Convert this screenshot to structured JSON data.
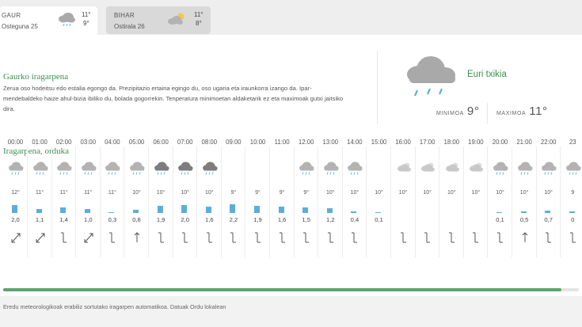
{
  "tabs": [
    {
      "label": "GAUR",
      "date": "Osteguna 25",
      "max": "11°",
      "min": "9°",
      "icon": "rain-cloud-icon"
    },
    {
      "label": "BIHAR",
      "date": "Ostirala 26",
      "max": "11°",
      "min": "8°",
      "icon": "sun-cloud-icon"
    }
  ],
  "today": {
    "title": "Gaurko iragarpena",
    "text": "Zerua oso hodeitsu edo estalia egongo da. Prezipitazio ertaina egingo du, oso ugaria eta iraunkorra izango da. Ipar-mendebaldeko haize ahul-bizia ibiliko du, bolada gogorrekin. Tenperatura minimoetan aldaketarik ez eta maximoak gutxi jaitsiko dira.",
    "condition": "Euri txikia",
    "min_label": "MINIMOA",
    "min_value": "9°",
    "max_label": "MAXIMOA",
    "max_value": "11°"
  },
  "hourly": {
    "title": "Iragarpena, orduka",
    "hours": [
      {
        "time": "00:00",
        "temp": "12°",
        "precip": "2,0",
        "mm": 2.0,
        "icon": "rain",
        "wind": "ne"
      },
      {
        "time": "01:00",
        "temp": "11°",
        "precip": "1,1",
        "mm": 1.1,
        "icon": "rain",
        "wind": "ne"
      },
      {
        "time": "02:00",
        "temp": "11°",
        "precip": "1,4",
        "mm": 1.4,
        "icon": "rain",
        "wind": "n"
      },
      {
        "time": "03:00",
        "temp": "11°",
        "precip": "1,0",
        "mm": 1.0,
        "icon": "rain",
        "wind": "ne"
      },
      {
        "time": "04:00",
        "temp": "11°",
        "precip": "0,3",
        "mm": 0.3,
        "icon": "rain",
        "wind": "n"
      },
      {
        "time": "05:00",
        "temp": "10°",
        "precip": "0,8",
        "mm": 0.8,
        "icon": "rain",
        "wind": "s"
      },
      {
        "time": "06:00",
        "temp": "10°",
        "precip": "1,9",
        "mm": 1.9,
        "icon": "rain-dark",
        "wind": "n"
      },
      {
        "time": "07:00",
        "temp": "10°",
        "precip": "2,0",
        "mm": 2.0,
        "icon": "rain-dark",
        "wind": "n"
      },
      {
        "time": "08:00",
        "temp": "10°",
        "precip": "1,6",
        "mm": 1.6,
        "icon": "rain-dark",
        "wind": "n"
      },
      {
        "time": "09:00",
        "temp": "9°",
        "precip": "2,2",
        "mm": 2.2,
        "icon": "none",
        "wind": "n"
      },
      {
        "time": "10:00",
        "temp": "9°",
        "precip": "1,9",
        "mm": 1.9,
        "icon": "none",
        "wind": "n"
      },
      {
        "time": "11:00",
        "temp": "9°",
        "precip": "1,6",
        "mm": 1.6,
        "icon": "none",
        "wind": "n"
      },
      {
        "time": "12:00",
        "temp": "9°",
        "precip": "1,5",
        "mm": 1.5,
        "icon": "rain",
        "wind": "n"
      },
      {
        "time": "13:00",
        "temp": "10°",
        "precip": "1,2",
        "mm": 1.2,
        "icon": "rain",
        "wind": "n"
      },
      {
        "time": "14:00",
        "temp": "10°",
        "precip": "0,4",
        "mm": 0.4,
        "icon": "rain",
        "wind": "n"
      },
      {
        "time": "15:00",
        "temp": "10°",
        "precip": "0,1",
        "mm": 0.1,
        "icon": "none",
        "wind": "none"
      },
      {
        "time": "16:00",
        "temp": "10°",
        "precip": "",
        "mm": 0,
        "icon": "cloud-sun",
        "wind": "n"
      },
      {
        "time": "17:00",
        "temp": "10°",
        "precip": "",
        "mm": 0,
        "icon": "cloud-sun",
        "wind": "n"
      },
      {
        "time": "18:00",
        "temp": "10°",
        "precip": "",
        "mm": 0,
        "icon": "cloud-sun",
        "wind": "n"
      },
      {
        "time": "19:00",
        "temp": "10°",
        "precip": "",
        "mm": 0,
        "icon": "cloud-sun",
        "wind": "n"
      },
      {
        "time": "20:00",
        "temp": "10°",
        "precip": "0,1",
        "mm": 0.1,
        "icon": "rain",
        "wind": "n"
      },
      {
        "time": "21:00",
        "temp": "10°",
        "precip": "0,5",
        "mm": 0.5,
        "icon": "rain",
        "wind": "s"
      },
      {
        "time": "22:00",
        "temp": "10°",
        "precip": "0,7",
        "mm": 0.7,
        "icon": "rain",
        "wind": "n"
      },
      {
        "time": "23",
        "temp": "9",
        "precip": "0",
        "mm": 0.5,
        "icon": "rain",
        "wind": "n"
      }
    ]
  },
  "progress_fraction": 0.97,
  "footer": "Eredu meteorologikoak erabiliz sortutako iragarpen automatikoa. Datuak Ordu lokalean",
  "colors": {
    "accent": "#3f8f4f",
    "bar": "#5baedc",
    "progress": "#5aa46c"
  }
}
